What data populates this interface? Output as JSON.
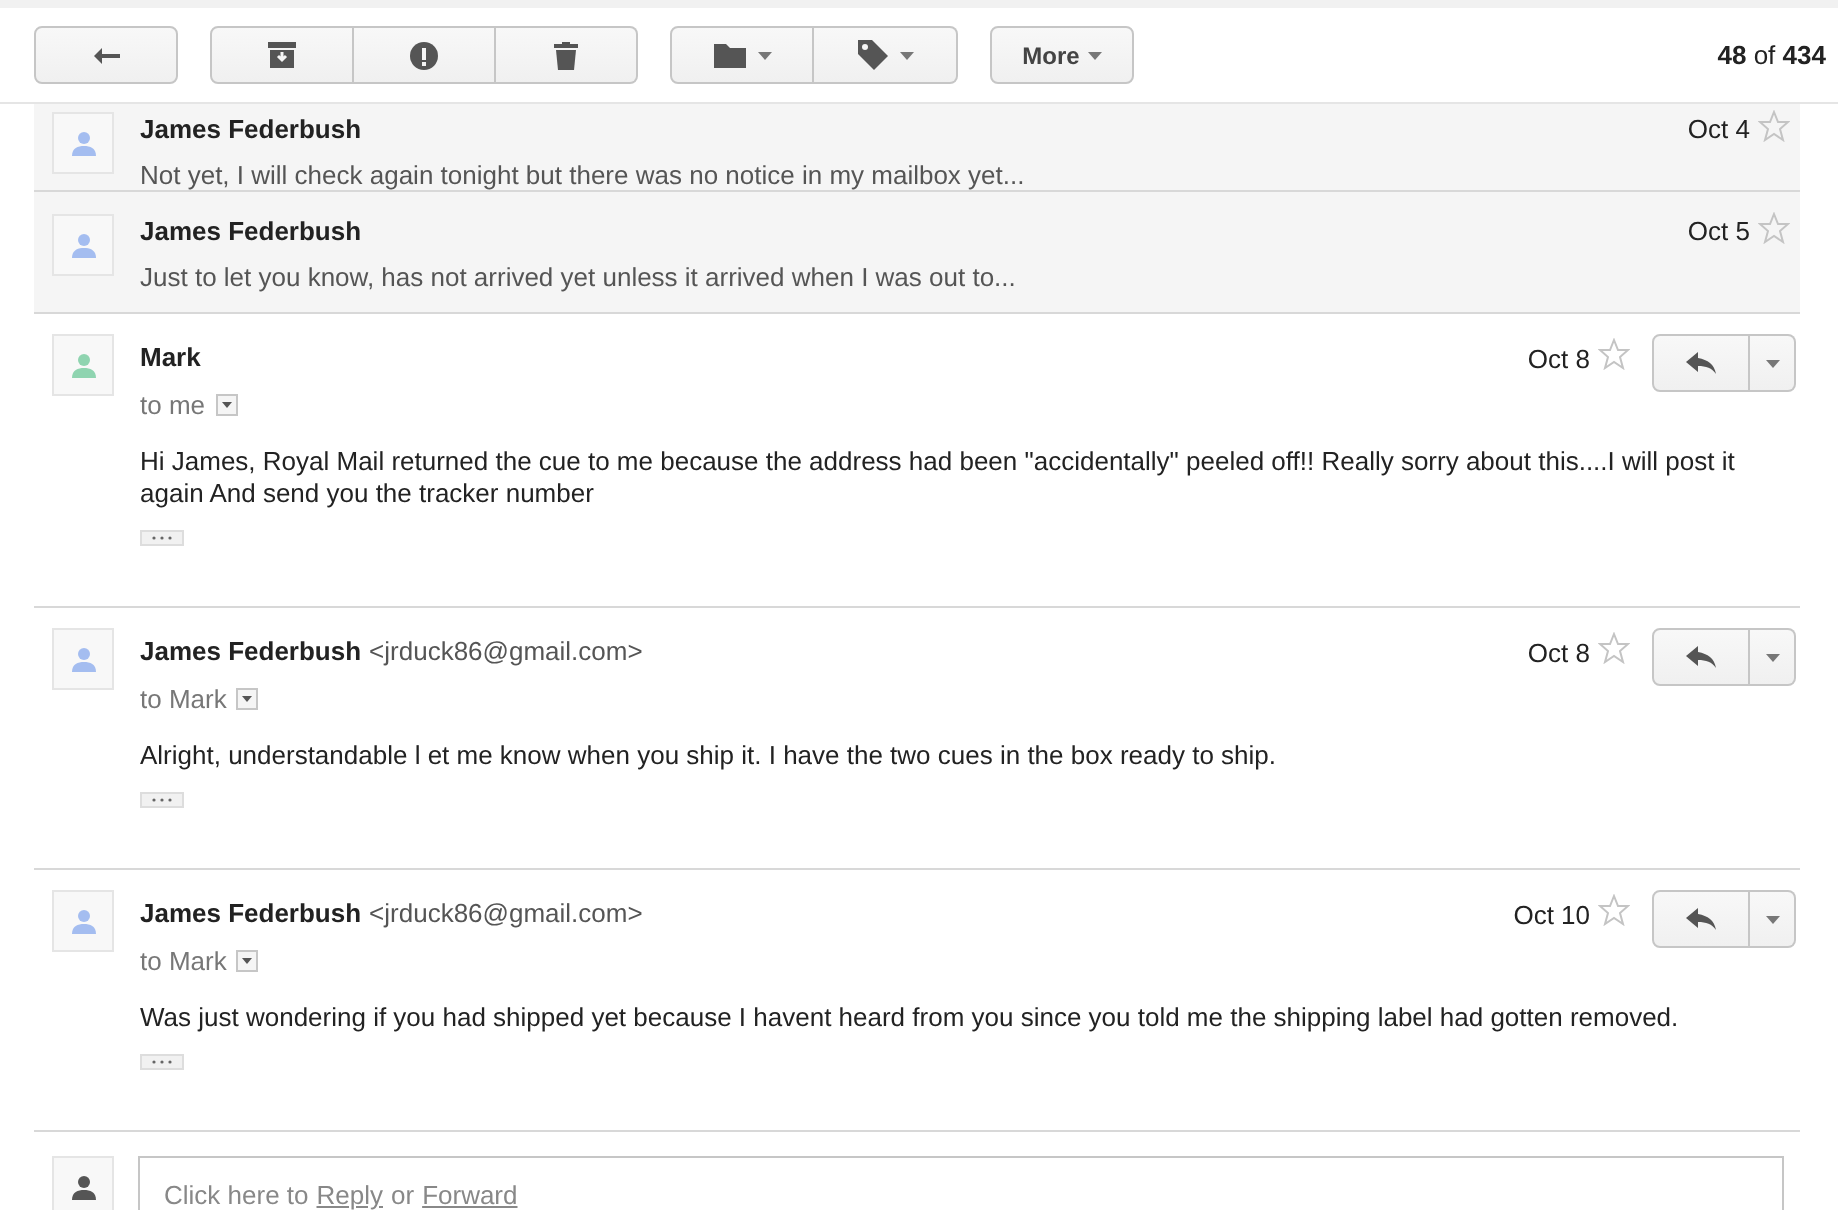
{
  "toolbar": {
    "more_label": "More",
    "counter": "**48** of **434**"
  },
  "messages": [
    {
      "kind": "collapsed",
      "sender": "James Federbush",
      "snippet": "Not yet, I will check again tonight but there was no notice in my mailbox yet...",
      "date": "Oct 4",
      "starred": false,
      "color": "#a4bdf0"
    },
    {
      "kind": "collapsed",
      "sender": "James Federbush",
      "snippet": "Just to let you know, has not arrived yet unless it arrived when I was out to...",
      "date": "Oct 5",
      "starred": false,
      "color": "#a4bdf0"
    },
    {
      "kind": "expanded",
      "sender": "Mark",
      "recipient": "to me",
      "body": "Hi James, Royal Mail returned the cue to me because the address had been \"accidentally\" peeled off!! Really sorry about this....I will post it again And send you the tracker number",
      "date": "Oct 8",
      "starred": false,
      "color": "#8fd4b0"
    },
    {
      "kind": "expanded",
      "sender": "James Federbush",
      "email": "<jrduck86@gmail.com>",
      "recipient": "to Mark",
      "body": "Alright, understandable l et me know when you ship it. I have the two cues in the box ready to ship.",
      "date": "Oct 8",
      "starred": false,
      "color": "#a4bdf0"
    },
    {
      "kind": "expanded",
      "sender": "James Federbush",
      "email": "<jrduck86@gmail.com>",
      "recipient": "to Mark",
      "body": "Was just wondering if you had shipped yet because I havent heard from you since you told me the shipping label had gotten removed.",
      "date": "Oct 10",
      "starred": false,
      "color": "#a4bdf0"
    }
  ],
  "reply_box": {
    "prefix": "Click here to",
    "reply_link": "Reply",
    "middle": "or",
    "forward_link": "Forward"
  }
}
